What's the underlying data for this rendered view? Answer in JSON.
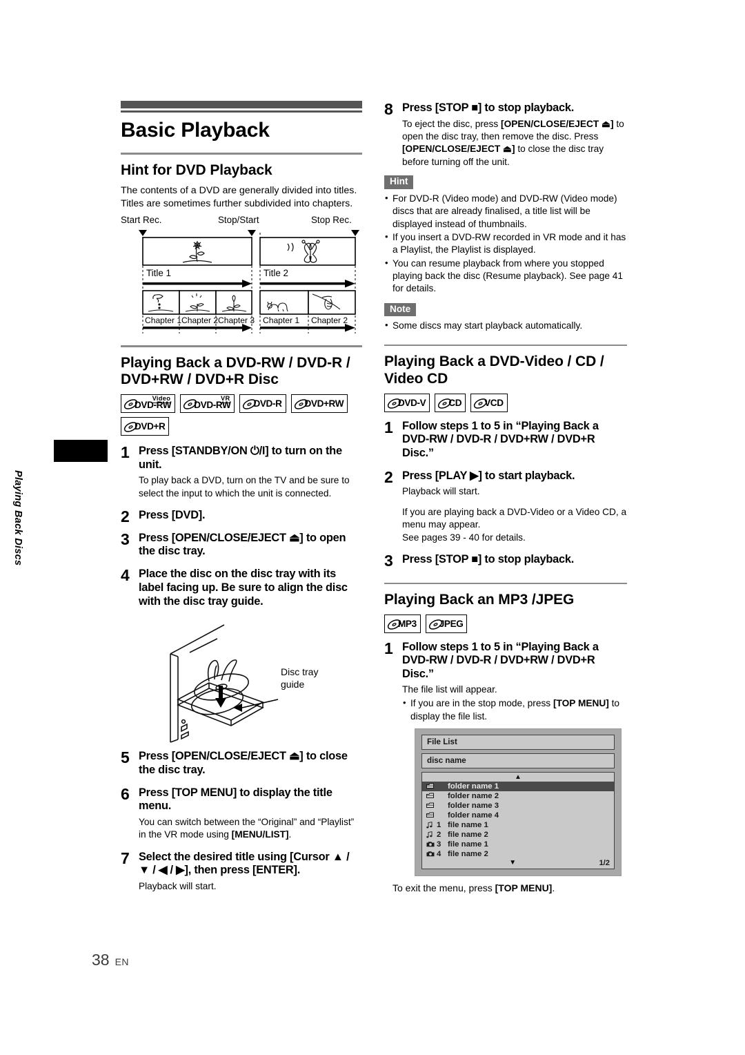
{
  "sidetab": {
    "label": "Playing Back Discs"
  },
  "footer": {
    "page_number": "38",
    "language": "EN"
  },
  "left": {
    "title": "Basic Playback",
    "hint_heading": "Hint for DVD Playback",
    "hint_paragraph": "The contents of a DVD are generally divided into titles. Titles are sometimes further subdivided into chapters.",
    "diagram": {
      "marker_start": "Start Rec.",
      "marker_mid": "Stop/Start",
      "marker_stop": "Stop Rec.",
      "title1": "Title 1",
      "title2": "Title 2",
      "chapters_title1": [
        "Chapter 1",
        "Chapter 2",
        "Chapter 3"
      ],
      "chapters_title2": [
        "Chapter 1",
        "Chapter 2"
      ]
    },
    "section_heading": "Playing Back a DVD-RW / DVD-R / DVD+RW / DVD+R Disc",
    "badges": [
      {
        "name": "DVD-RW",
        "sup": "Video"
      },
      {
        "name": "DVD-RW",
        "sup": "VR"
      },
      {
        "name": "DVD-R",
        "sup": ""
      },
      {
        "name": "DVD+RW",
        "sup": ""
      },
      {
        "name": "DVD+R",
        "sup": ""
      }
    ],
    "steps": [
      {
        "num": "1",
        "title": "Press [STANDBY/ON ⏻/I] to turn on the unit.",
        "desc": "To play back a DVD, turn on the TV and be sure to select the input to which the unit is connected."
      },
      {
        "num": "2",
        "title": "Press [DVD].",
        "desc": ""
      },
      {
        "num": "3",
        "title": "Press [OPEN/CLOSE/EJECT ⏏] to open the disc tray.",
        "desc": ""
      },
      {
        "num": "4",
        "title": "Place the disc on the disc tray with its label facing up. Be sure to align the disc with the disc tray guide.",
        "desc": ""
      },
      {
        "num": "5",
        "title": "Press [OPEN/CLOSE/EJECT ⏏] to close the disc tray.",
        "desc": ""
      },
      {
        "num": "6",
        "title": "Press [TOP MENU] to display the title menu.",
        "desc": ""
      },
      {
        "num": "7",
        "title": "Select the desired title using [Cursor ▲ / ▼ / ◀ / ▶], then press [ENTER].",
        "desc": "Playback will start."
      }
    ],
    "step6_desc_pre": "You can switch between the “Original” and “Playlist” in the VR mode using ",
    "step6_desc_bold": "[MENU/LIST]",
    "step6_desc_post": ".",
    "tray_caption": "Disc tray\nguide"
  },
  "right": {
    "step8": {
      "num": "8",
      "title": "Press [STOP ■] to stop playback.",
      "desc_1": "To eject the disc, press ",
      "desc_b1": "[OPEN/CLOSE/EJECT ⏏]",
      "desc_2": " to open the disc tray, then remove the disc. Press ",
      "desc_b2": "[OPEN/CLOSE/EJECT ⏏]",
      "desc_3": " to close the disc tray before turning off the unit."
    },
    "hint_tag": "Hint",
    "hint_bullets": [
      "For DVD-R (Video mode) and DVD-RW (Video mode) discs that are already finalised, a title list will be displayed instead of thumbnails.",
      "If you insert a DVD-RW recorded in VR mode and it has a Playlist, the Playlist is displayed.",
      "You can resume playback from where you stopped playing back the disc (Resume playback). See page 41 for details."
    ],
    "note_tag": "Note",
    "note_bullets": [
      "Some discs may start playback automatically."
    ],
    "section2_heading": "Playing Back a DVD-Video / CD / Video CD",
    "section2_badges": [
      {
        "name": "DVD-V",
        "sup": ""
      },
      {
        "name": "CD",
        "sup": ""
      },
      {
        "name": "VCD",
        "sup": ""
      }
    ],
    "section2_steps": [
      {
        "num": "1",
        "title": "Follow steps 1 to 5 in “Playing Back a DVD-RW / DVD-R / DVD+RW / DVD+R Disc.”",
        "desc": ""
      },
      {
        "num": "2",
        "title": "Press [PLAY ▶] to start playback.",
        "desc": "Playback will start."
      },
      {
        "num": "3",
        "title": "Press [STOP ■] to stop playback.",
        "desc": ""
      }
    ],
    "step2_desc_extra_1": "If you are playing back a DVD-Video or a Video CD, a menu may appear.",
    "step2_desc_extra_2": "See pages 39 - 40 for details.",
    "section3_heading": "Playing Back an MP3 /JPEG",
    "section3_badges": [
      {
        "name": "MP3",
        "sup": ""
      },
      {
        "name": "JPEG",
        "sup": ""
      }
    ],
    "section3_step": {
      "num": "1",
      "title": "Follow steps 1 to 5 in “Playing Back a DVD-RW / DVD-R / DVD+RW / DVD+R Disc.”",
      "desc": "The file list will appear.",
      "bullet_pre": "If you are in the stop mode, press ",
      "bullet_bold": "[TOP MENU]",
      "bullet_post": " to display the file list."
    },
    "osd": {
      "header": "File List",
      "disc_name": "disc name",
      "rows": [
        {
          "icon": "folder-icon",
          "index": "",
          "label": "folder name 1",
          "selected": true
        },
        {
          "icon": "folder-icon",
          "index": "",
          "label": "folder name 2",
          "selected": false
        },
        {
          "icon": "folder-icon",
          "index": "",
          "label": "folder name 3",
          "selected": false
        },
        {
          "icon": "folder-icon",
          "index": "",
          "label": "folder name 4",
          "selected": false
        },
        {
          "icon": "music-note-icon",
          "index": "1",
          "label": "file name 1",
          "selected": false
        },
        {
          "icon": "music-note-icon",
          "index": "2",
          "label": "file name 2",
          "selected": false
        },
        {
          "icon": "camera-icon",
          "index": "3",
          "label": "file name 1",
          "selected": false
        },
        {
          "icon": "camera-icon",
          "index": "4",
          "label": "file name 2",
          "selected": false
        }
      ],
      "page_indicator": "1/2"
    },
    "osd_caption_pre": "To exit the menu, press ",
    "osd_caption_bold": "[TOP MENU]",
    "osd_caption_post": "."
  }
}
